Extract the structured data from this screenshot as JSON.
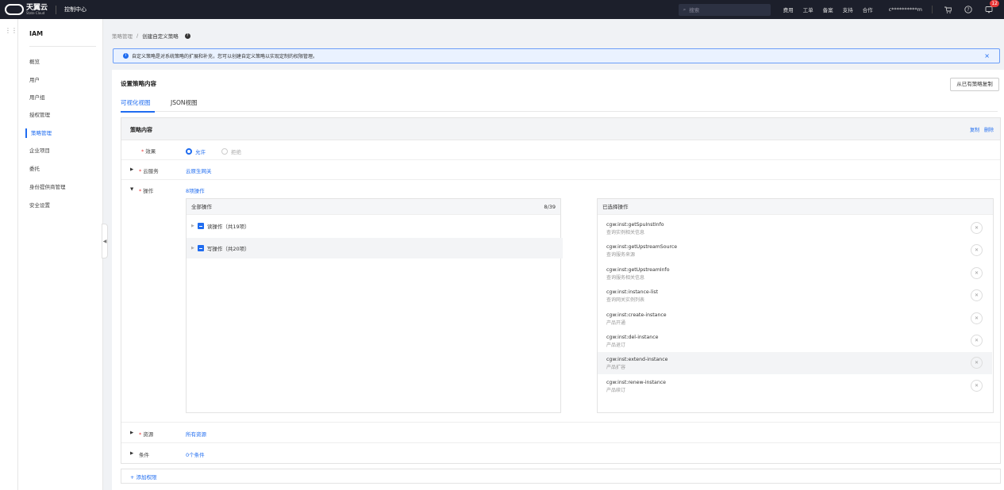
{
  "topbar": {
    "logo_cn": "天翼云",
    "logo_en": "State Cloud",
    "console": "控制中心",
    "search_placeholder": "搜索",
    "links": [
      "费用",
      "工单",
      "备案",
      "支持",
      "合作"
    ],
    "user": "c**********m",
    "notif_count": "12"
  },
  "sidebar": {
    "title": "IAM",
    "items": [
      "概览",
      "用户",
      "用户组",
      "授权管理",
      "策略管理",
      "企业项目",
      "委托",
      "身份提供商管理",
      "安全设置"
    ],
    "active": "策略管理"
  },
  "breadcrumb": {
    "parent": "策略管理",
    "sep": "/",
    "current": "创建自定义策略"
  },
  "info": {
    "text": "自定义策略是对系统策略的扩展和补充，您可以创建自定义策略以实现定制的权限管理。"
  },
  "card": {
    "title": "设置策略内容",
    "copy_button": "从已有策略复制",
    "tabs": [
      "可视化视图",
      "JSON视图"
    ]
  },
  "policy": {
    "title": "策略内容",
    "actions": [
      "复制",
      "删除"
    ],
    "effect": {
      "label": "效果",
      "options": [
        "允许",
        "拒绝"
      ],
      "selected": "允许"
    },
    "service": {
      "label": "云服务",
      "value": "云原生网关"
    },
    "operation": {
      "label": "操作",
      "value": "8项操作"
    },
    "resource": {
      "label": "资源",
      "value": "所有资源"
    },
    "condition": {
      "label": "条件",
      "value": "0个条件"
    },
    "all_ops": {
      "title": "全部操作",
      "count": "8/39",
      "groups": [
        "读操作（共19项）",
        "写操作（共20项）"
      ]
    },
    "selected_ops": {
      "title": "已选择操作",
      "items": [
        {
          "name": "cgw:inst:getSpuInstInfo",
          "desc": "查询实例相关信息"
        },
        {
          "name": "cgw:inst:getUpstreamSource",
          "desc": "查询服务来源"
        },
        {
          "name": "cgw:inst:getUpstreamInfo",
          "desc": "查询服务相关信息"
        },
        {
          "name": "cgw:inst:instance-list",
          "desc": "查询网关实例列表"
        },
        {
          "name": "cgw:inst:create-instance",
          "desc": "产品开通"
        },
        {
          "name": "cgw:inst:del-instance",
          "desc": "产品退订"
        },
        {
          "name": "cgw:inst:extend-instance",
          "desc": "产品扩容"
        },
        {
          "name": "cgw:inst:renew-instance",
          "desc": "产品续订"
        }
      ]
    },
    "add_permission": "+ 添加权限"
  },
  "colors": {
    "accent": "#1f6cf0",
    "topbar": "#1c1f2b",
    "required": "#e83a3a"
  }
}
